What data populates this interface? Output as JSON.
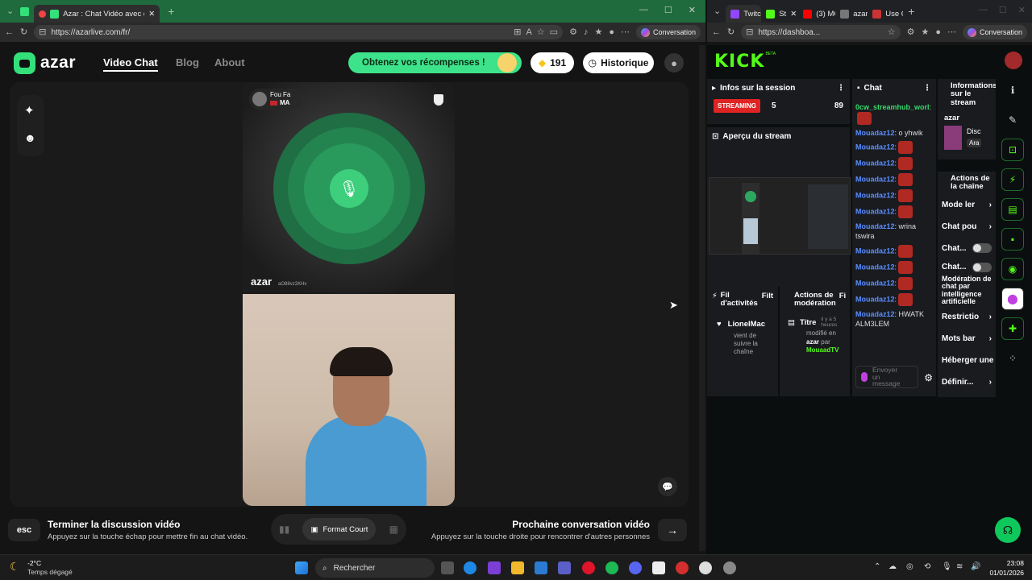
{
  "left_browser": {
    "tab_title": "Azar : Chat Vidéo avec de no",
    "url": "https://azarlive.com/fr/",
    "conversation_label": "Conversation"
  },
  "right_browser": {
    "tabs": [
      "Twitch",
      "St",
      "(3) MC",
      "azar -",
      "Use Ol"
    ],
    "url": "https://dashboa...",
    "conversation_label": "Conversation"
  },
  "azar": {
    "brand": "azar",
    "nav": [
      "Video Chat",
      "Blog",
      "About"
    ],
    "rewards_label": "Obtenez vos récompenses !",
    "gems": "191",
    "history_label": "Historique",
    "remote": {
      "name": "Fou Fa",
      "country": "MA",
      "watermark": "azar",
      "watermark_id": "aO88vz3XHv"
    },
    "esc_key": "esc",
    "end_title": "Terminer la discussion vidéo",
    "end_desc": "Appuyez sur la touche échap pour mettre fin au chat vidéo.",
    "format_label": "Format Court",
    "next_title": "Prochaine conversation vidéo",
    "next_desc": "Appuyez sur la touche droite pour rencontrer d'autres personnes"
  },
  "kick": {
    "logo": "KICK",
    "logo_badge": "BETA",
    "session_title": "Infos sur la session",
    "streaming_badge": "STREAMING",
    "viewers": "5",
    "other_stat": "89",
    "preview_title": "Aperçu du stream",
    "activity_title": "Fil d'activités",
    "activity_filter": "Filt",
    "activity_user": "LionelMac",
    "activity_text": "vient de suivre la chaîne",
    "moderation_title": "Actions de modération",
    "moderation_filter": "Fi",
    "moderation_item_title": "Titre",
    "moderation_item_time": "il y a 5 heures",
    "moderation_item_text": "modifié en",
    "moderation_item_value": "azar",
    "moderation_item_by": "par",
    "moderation_item_user": "MouaadTV",
    "chat_title": "Chat",
    "chat_messages": [
      {
        "user": "0cw_streamhub_worl",
        "text": ":"
      },
      {
        "user": "Mouadaz12",
        "text": ": o yhwik"
      },
      {
        "user": "Mouadaz12",
        "text": ":"
      },
      {
        "user": "Mouadaz12",
        "text": ":"
      },
      {
        "user": "Mouadaz12",
        "text": ":"
      },
      {
        "user": "Mouadaz12",
        "text": ":"
      },
      {
        "user": "Mouadaz12",
        "text": ":"
      },
      {
        "user": "Mouadaz12",
        "text": ": wrina tswira"
      },
      {
        "user": "Mouadaz12",
        "text": ":"
      },
      {
        "user": "Mouadaz12",
        "text": ":"
      },
      {
        "user": "Mouadaz12",
        "text": ":"
      },
      {
        "user": "Mouadaz12",
        "text": ":"
      },
      {
        "user": "Mouadaz12",
        "text": ": HWATK ALM3LEM"
      }
    ],
    "chat_placeholder": "Envoyer un message",
    "info_title": "Informations sur le stream",
    "info_category": "azar",
    "info_tag1": "Disc",
    "info_tag2": "Ara",
    "actions_title": "Actions de la chaîne",
    "actions": [
      "Mode ler",
      "Chat pou",
      "Chat...",
      "Chat...",
      "Modération de chat par intelligence artificielle",
      "Restrictio",
      "Mots bar",
      "Héberger une",
      "Définir..."
    ]
  },
  "taskbar": {
    "temp": "-2°C",
    "weather": "Temps dégagé",
    "search": "Rechercher",
    "time": "23:08",
    "date": "01/01/2026"
  }
}
